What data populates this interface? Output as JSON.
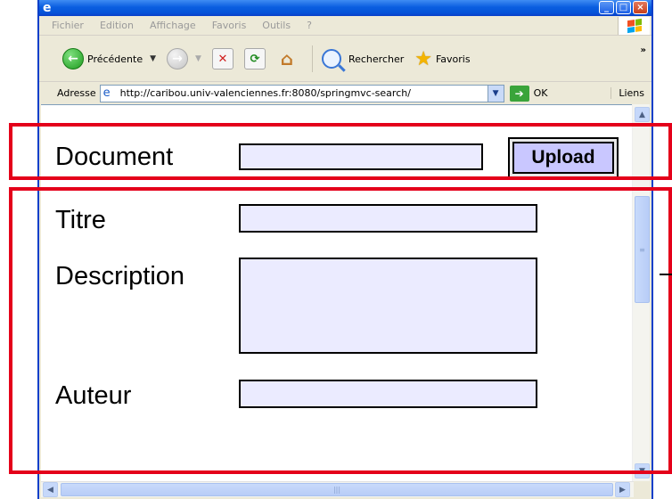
{
  "menubar": {
    "items": [
      "Fichier",
      "Edition",
      "Affichage",
      "Favoris",
      "Outils",
      "?"
    ]
  },
  "toolbar": {
    "back_label": "Précédente",
    "search_label": "Rechercher",
    "favorites_label": "Favoris"
  },
  "addressbar": {
    "label": "Adresse",
    "url": "http://caribou.univ-valenciennes.fr:8080/springmvc-search/",
    "go_label": "OK",
    "links_label": "Liens"
  },
  "form": {
    "document_label": "Document",
    "document_value": "",
    "upload_label": "Upload",
    "titre_label": "Titre",
    "titre_value": "",
    "description_label": "Description",
    "description_value": "",
    "auteur_label": "Auteur",
    "auteur_value": ""
  },
  "colors": {
    "highlight_border": "#e4001a",
    "input_fill": "#ebebff",
    "upload_fill": "#c9c7ff"
  },
  "icons": [
    "ie-icon",
    "minimize-icon",
    "maximize-icon",
    "close-icon",
    "windows-logo-icon",
    "back-arrow-icon",
    "forward-arrow-icon",
    "stop-icon",
    "refresh-icon",
    "home-icon",
    "search-icon",
    "favorites-star-icon",
    "page-icon",
    "go-arrow-icon"
  ]
}
